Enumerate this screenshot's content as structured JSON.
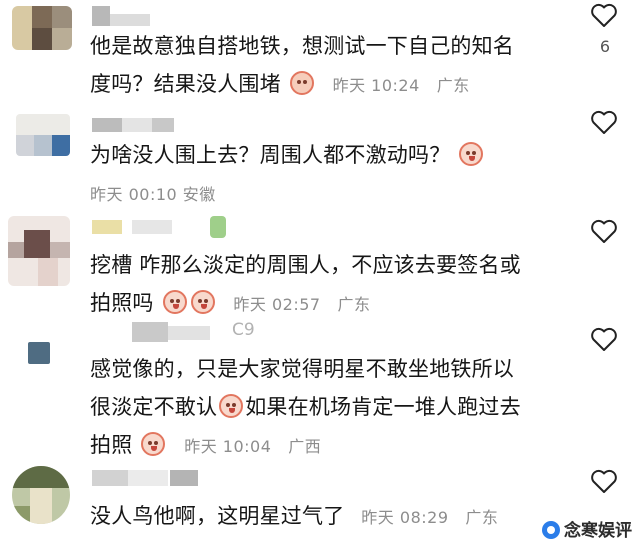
{
  "comments": [
    {
      "lines": [
        "他是故意独自搭地铁，想测试一下自己的知名",
        "度吗？结果没人围堵"
      ],
      "emoji": "face-emoji",
      "time": "昨天 10:24",
      "location": "广东",
      "like_count": "6"
    },
    {
      "lines": [
        "为啥没人围上去？周围人都不激动吗？"
      ],
      "emoji": "shocked-face-emoji",
      "time": "昨天 00:10",
      "location": "安徽"
    },
    {
      "lines": [
        "挖槽  咋那么淡定的周围人，不应该去要签名或",
        "拍照吗"
      ],
      "emoji": "crying-face-emoji",
      "time": "昨天 02:57",
      "location": "广东"
    },
    {
      "username_fragment": "C9",
      "lines": [
        "感觉像的，只是大家觉得明星不敢坐地铁所以",
        "很淡定不敢认",
        "如果在机场肯定一堆人跑过去",
        "拍照"
      ],
      "emoji": "crying-face-emoji",
      "time": "昨天 10:04",
      "location": "广西"
    },
    {
      "lines": [
        "没人鸟他啊，这明星过气了"
      ],
      "time": "昨天 08:29",
      "location": "广东"
    }
  ],
  "watermark": "念寒娱评",
  "icons": {
    "like": "heart-outline-icon"
  },
  "colors": {
    "meta": "#8d8d8d",
    "text": "#161616",
    "emoji_outline": "#e2765f"
  }
}
